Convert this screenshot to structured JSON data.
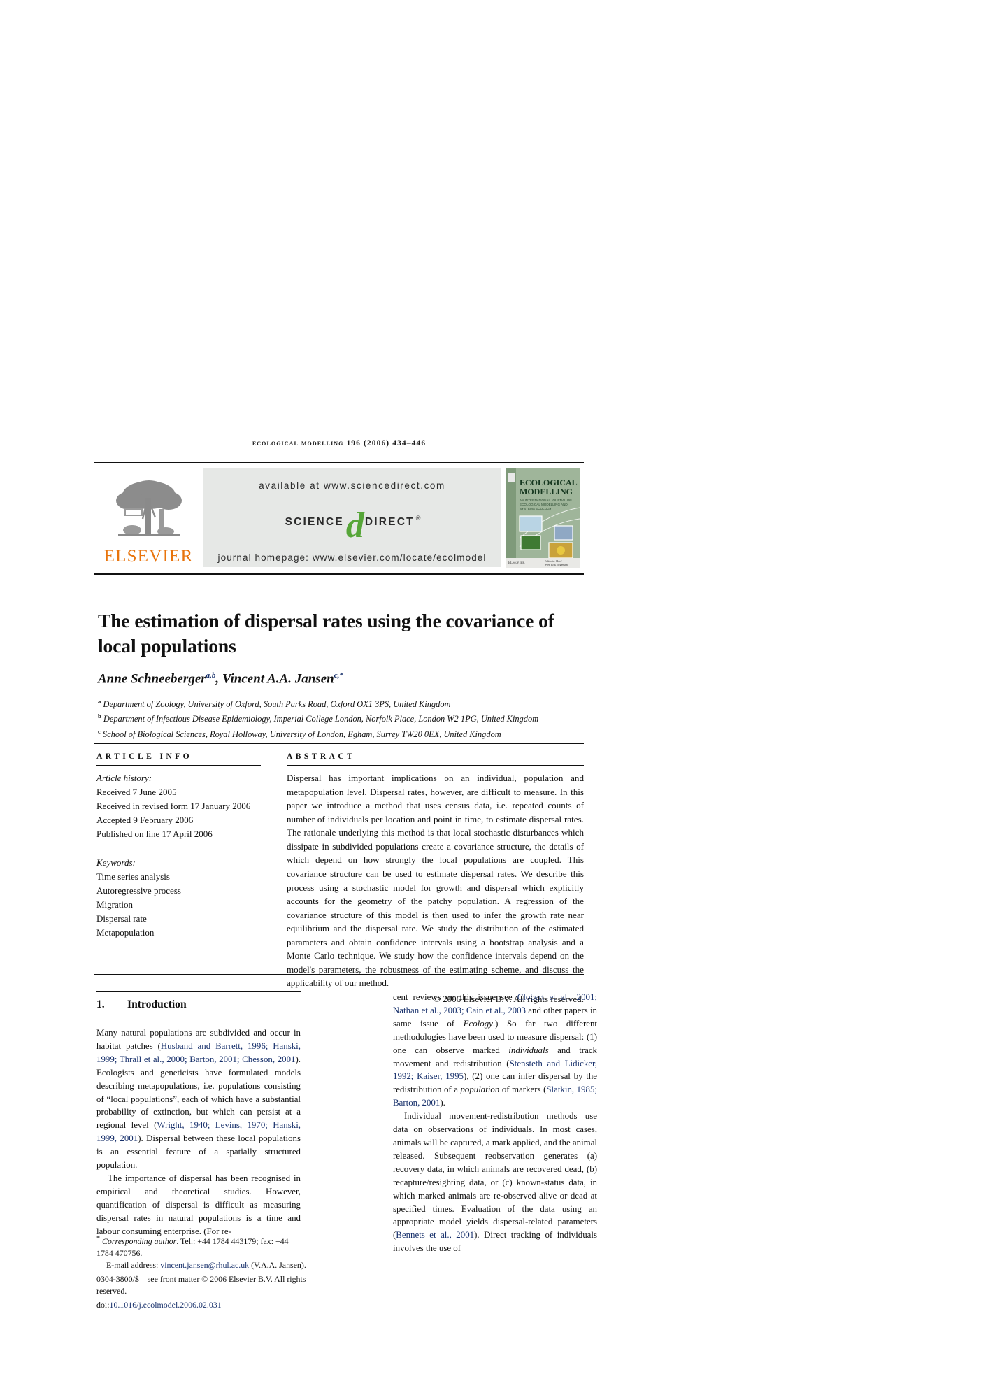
{
  "running_head": "ecological modelling 196 (2006) 434–446",
  "masthead": {
    "publisher_name": "ELSEVIER",
    "publisher_logo_icon": "elsevier-tree-icon",
    "available_at": "available at www.sciencedirect.com",
    "sciencedirect_science": "SCIENCE",
    "sciencedirect_d": "d",
    "sciencedirect_direct": "DIRECT",
    "sciencedirect_registered": "®",
    "journal_homepage": "journal homepage: www.elsevier.com/locate/ecolmodel",
    "cover": {
      "line1": "ECOLOGICAL",
      "line2": "MODELLING",
      "subtitle": "AN INTERNATIONAL JOURNAL ON ECOLOGICAL MODELLING AND SYSTEMS ECOLOGY",
      "footer_left": "ELSEVIER",
      "footer_right": "Editor-in-Chief\nSven Erik Jørgensen"
    }
  },
  "article": {
    "title": "The estimation of dispersal rates using the covariance of local populations",
    "authors": [
      {
        "name": "Anne Schneeberger",
        "marks": "a,b",
        "sep": ", "
      },
      {
        "name": "Vincent A.A. Jansen",
        "marks": "c,*",
        "sep": ""
      }
    ],
    "affiliations": [
      {
        "mark": "a",
        "text": "Department of Zoology, University of Oxford, South Parks Road, Oxford OX1 3PS, United Kingdom"
      },
      {
        "mark": "b",
        "text": "Department of Infectious Disease Epidemiology, Imperial College London, Norfolk Place, London W2 1PG, United Kingdom"
      },
      {
        "mark": "c",
        "text": "School of Biological Sciences, Royal Holloway, University of London, Egham, Surrey TW20 0EX, United Kingdom"
      }
    ]
  },
  "article_info": {
    "heading": "ARTICLE INFO",
    "history_label": "Article history:",
    "history": [
      "Received 7 June 2005",
      "Received in revised form 17 January 2006",
      "Accepted 9 February 2006",
      "Published on line 17 April 2006"
    ],
    "keywords_label": "Keywords:",
    "keywords": [
      "Time series analysis",
      "Autoregressive process",
      "Migration",
      "Dispersal rate",
      "Metapopulation"
    ]
  },
  "abstract": {
    "heading": "ABSTRACT",
    "text": "Dispersal has important implications on an individual, population and metapopulation level. Dispersal rates, however, are difficult to measure. In this paper we introduce a method that uses census data, i.e. repeated counts of number of individuals per location and point in time, to estimate dispersal rates. The rationale underlying this method is that local stochastic disturbances which dissipate in subdivided populations create a covariance structure, the details of which depend on how strongly the local populations are coupled. This covariance structure can be used to estimate dispersal rates. We describe this process using a stochastic model for growth and dispersal which explicitly accounts for the geometry of the patchy population. A regression of the covariance structure of this model is then used to infer the growth rate near equilibrium and the dispersal rate. We study the distribution of the estimated parameters and obtain confidence intervals using a bootstrap analysis and a Monte Carlo technique. We study how the confidence intervals depend on the model's parameters, the robustness of the estimating scheme, and discuss the applicability of our method.",
    "copyright": "© 2006 Elsevier B.V. All rights reserved."
  },
  "introduction": {
    "number": "1.",
    "title": "Introduction",
    "left_paragraphs": [
      {
        "segments": [
          {
            "t": "Many natural populations are subdivided and occur in habitat patches (",
            "s": "plain"
          },
          {
            "t": "Husband and Barrett, 1996; Hanski, 1999; Thrall et al., 2000; Barton, 2001; Chesson, 2001",
            "s": "cite"
          },
          {
            "t": "). Ecologists and geneticists have formulated models describing metapopulations, i.e. populations consisting of “local populations”, each of which have a substantial probability of extinction, but which can persist at a regional level (",
            "s": "plain"
          },
          {
            "t": "Wright, 1940; Levins, 1970; Hanski, 1999, 2001",
            "s": "cite"
          },
          {
            "t": "). Dispersal between these local populations is an essential feature of a spatially structured population.",
            "s": "plain"
          }
        ]
      },
      {
        "segments": [
          {
            "t": "The importance of dispersal has been recognised in empirical and theoretical studies. However, quantification of dispersal is difficult as measuring dispersal rates in natural populations is a time and labour consuming enterprise. (For re-",
            "s": "plain"
          }
        ]
      }
    ],
    "right_paragraphs": [
      {
        "segments": [
          {
            "t": "cent reviews on this issue see ",
            "s": "plain"
          },
          {
            "t": "Clobert et al., 2001; Nathan et al., 2003; Cain et al., 2003",
            "s": "cite"
          },
          {
            "t": " and other papers in same issue of ",
            "s": "plain"
          },
          {
            "t": "Ecology",
            "s": "ital"
          },
          {
            "t": ".) So far two different methodologies have been used to measure dispersal: (1) one can observe marked ",
            "s": "plain"
          },
          {
            "t": "individuals",
            "s": "ital"
          },
          {
            "t": " and track movement and redistribution (",
            "s": "plain"
          },
          {
            "t": "Stensteth and Lidicker, 1992; Kaiser, 1995",
            "s": "cite"
          },
          {
            "t": "), (2) one can infer dispersal by the redistribution of a ",
            "s": "plain"
          },
          {
            "t": "population",
            "s": "ital"
          },
          {
            "t": " of markers (",
            "s": "plain"
          },
          {
            "t": "Slatkin, 1985; Barton, 2001",
            "s": "cite"
          },
          {
            "t": ").",
            "s": "plain"
          }
        ]
      },
      {
        "segments": [
          {
            "t": "Individual movement-redistribution methods use data on observations of individuals. In most cases, animals will be captured, a mark applied, and the animal released. Subsequent reobservation generates (a) recovery data, in which animals are recovered dead, (b) recapture/resighting data, or (c) known-status data, in which marked animals are re-observed alive or dead at specified times. Evaluation of the data using an appropriate model yields dispersal-related parameters (",
            "s": "plain"
          },
          {
            "t": "Bennets et al., 2001",
            "s": "cite"
          },
          {
            "t": "). Direct tracking of individuals involves the use of",
            "s": "plain"
          }
        ]
      }
    ]
  },
  "footnotes": {
    "corresponding_mark": "*",
    "corresponding_label": "Corresponding author",
    "corresponding_text": ". Tel.: +44 1784 443179; fax: +44 1784 470756.",
    "email_label": "E-mail address: ",
    "email": "vincent.jansen@rhul.ac.uk",
    "email_suffix": " (V.A.A. Jansen).",
    "issn_line": "0304-3800/$ – see front matter © 2006 Elsevier B.V. All rights reserved.",
    "doi_label": "doi:",
    "doi": "10.1016/j.ecolmodel.2006.02.031"
  },
  "colors": {
    "citation_blue": "#17306b",
    "elsevier_orange": "#E8740C",
    "sciencedirect_green": "#57a639",
    "band_grey": "#e6e8e6"
  }
}
